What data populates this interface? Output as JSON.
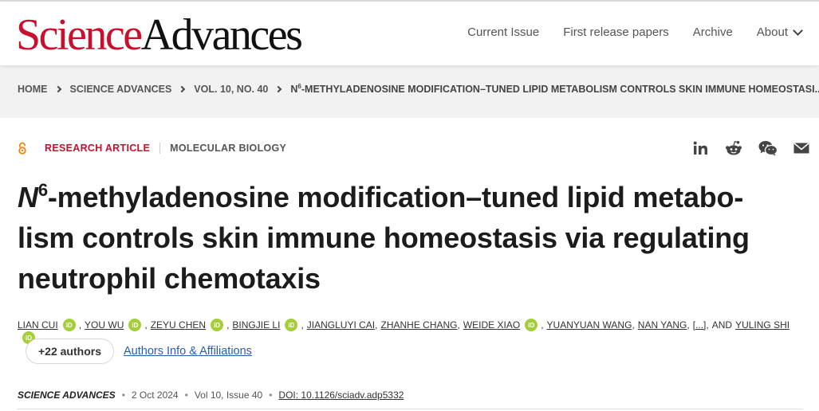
{
  "header": {
    "logo_science": "Science",
    "logo_advances": "Advances",
    "nav": [
      "Current Issue",
      "First release papers",
      "Archive",
      "About"
    ]
  },
  "breadcrumb": [
    "HOME",
    "SCIENCE ADVANCES",
    "VOL. 10, NO. 40"
  ],
  "breadcrumb_last": {
    "prefix": "N",
    "sup": "6",
    "rest": "-METHYLADENOSINE MODIFICATION–TUNED LIPID METABOLISM CONTROLS SKIN IMMUNE HOMEOSTASI..."
  },
  "article_meta": {
    "type": "RESEARCH ARTICLE",
    "subject": "MOLECULAR BIOLOGY"
  },
  "share_icons": [
    "linkedin-icon",
    "reddit-icon",
    "wechat-icon",
    "email-icon"
  ],
  "title": {
    "italic": "N",
    "sup": "6",
    "line1_rest": "-methyladenosine modification–tuned lipid metabo-",
    "line2": "lism controls skin immune homeostasis via regulating",
    "line3": "neutrophil chemotaxis"
  },
  "authors": {
    "names": [
      "LIAN CUI",
      "YOU WU",
      "ZEYU CHEN",
      "BINGJIE LI",
      "JIANGLUYI CAI",
      "ZHANHE CHANG",
      "WEIDE XIAO",
      "YUANYUAN WANG",
      "NAN YANG",
      "YULING SHI"
    ],
    "ellipsis": "[...]",
    "and": "AND",
    "orcid_label": "iD",
    "more_button": "+22 authors",
    "affiliations_link": "Authors Info & Affiliations"
  },
  "publication": {
    "journal": "SCIENCE ADVANCES",
    "date": "2 Oct 2024",
    "volume": "Vol 10, Issue 40",
    "doi": "DOI: 10.1126/sciadv.adp5332"
  },
  "colors": {
    "brand_red": "#c8102e",
    "orcid_green": "#a6ce39",
    "link_blue": "#2a5db0",
    "open_access_orange": "#f68212"
  }
}
